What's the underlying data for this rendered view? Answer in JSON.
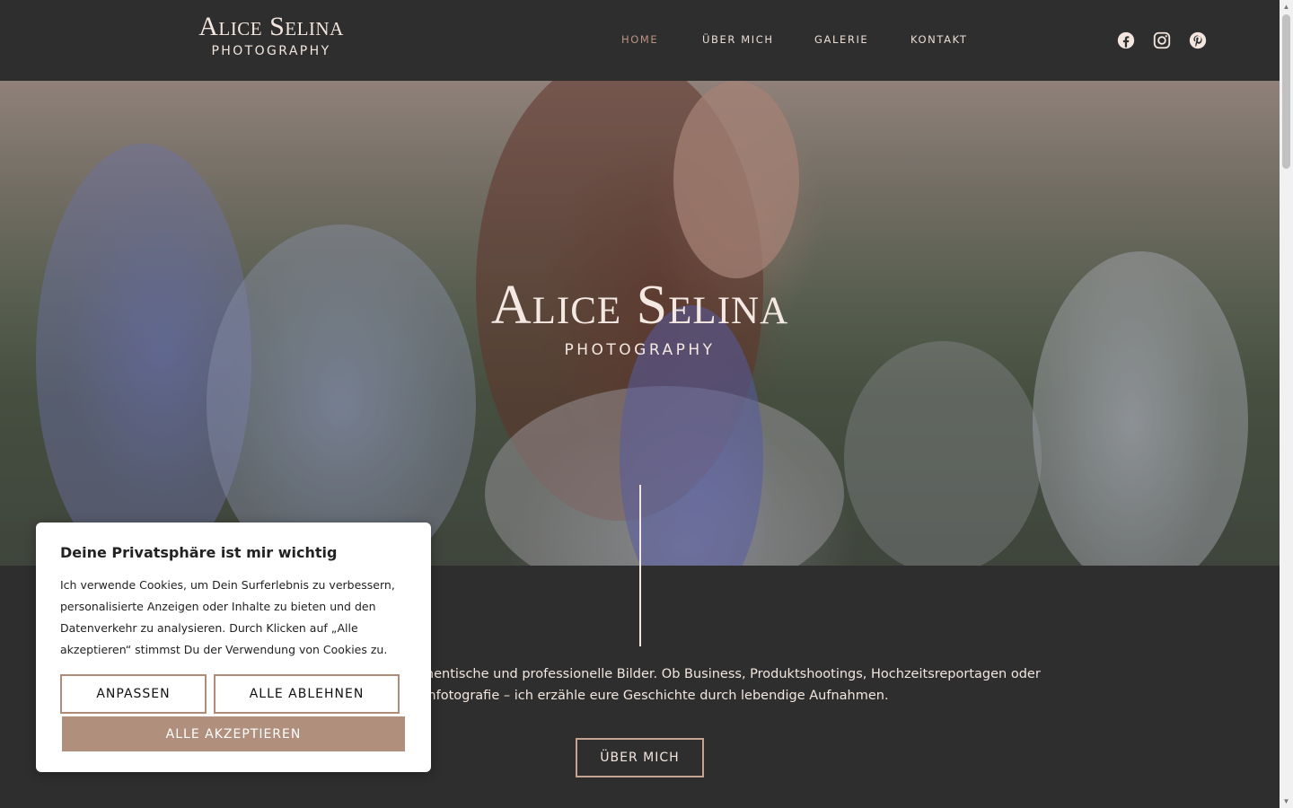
{
  "header": {
    "logo_name": "Alice Selina",
    "logo_sub": "PHOTOGRAPHY",
    "nav": [
      {
        "label": "HOME",
        "active": true
      },
      {
        "label": "ÜBER MICH",
        "active": false
      },
      {
        "label": "GALERIE",
        "active": false
      },
      {
        "label": "KONTAKT",
        "active": false
      }
    ],
    "social": [
      "facebook-icon",
      "instagram-icon",
      "pinterest-icon"
    ]
  },
  "hero": {
    "title": "Alice Selina",
    "subtitle": "PHOTOGRAPHY"
  },
  "intro": {
    "text": "n mit Leidenschaft für authentische und professionelle Bilder. Ob Business, Produktshootings, Hochzeitsreportagen oder ilienfotografie – ich erzähle eure Geschichte durch lebendige Aufnahmen.",
    "line1": "n mit Leidenschaft für authentische und professionelle Bilder. Ob Business, Produktshootings, Hochzeitsreportagen oder",
    "line2": "ilienfotografie – ich erzähle eure Geschichte durch lebendige Aufnahmen.",
    "cta_label": "ÜBER MICH"
  },
  "cookie": {
    "title": "Deine Privatsphäre ist mir wichtig",
    "text": "Ich verwende Cookies, um Dein Surferlebnis zu verbessern, personalisierte Anzeigen oder Inhalte zu bieten und den Datenverkehr zu analysieren. Durch Klicken auf „Alle akzeptieren“ stimmst Du der Verwendung von Cookies zu.",
    "customize_label": "ANPASSEN",
    "reject_label": "ALLE ABLEHNEN",
    "accept_label": "ALLE AKZEPTIEREN"
  },
  "colors": {
    "background": "#2f2e2e",
    "text": "#f2e6df",
    "accent": "#b08f7d",
    "nav_active": "#b99382"
  }
}
